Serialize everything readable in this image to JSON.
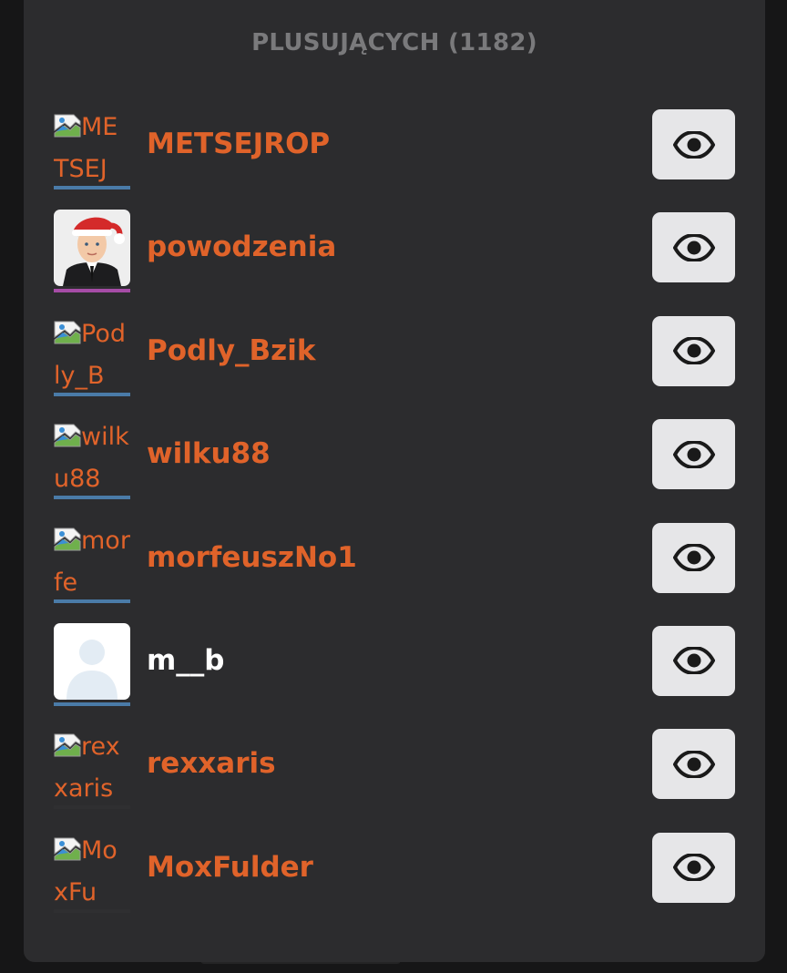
{
  "modal": {
    "title": "PLUSUJĄCYCH (1182)"
  },
  "colors": {
    "accent": "#e0632a",
    "name_white": "#ffffff",
    "bar_blue": "#4a7ba8",
    "bar_purple": "#a64ca6",
    "bar_dark": "#2f2f31"
  },
  "users": [
    {
      "name": "METSEJROP",
      "alt": "METSEJ",
      "avatar": "broken",
      "name_color": "#e0632a",
      "bar": "#4a7ba8"
    },
    {
      "name": "powodzenia",
      "alt": "",
      "avatar": "photo-santa",
      "name_color": "#e0632a",
      "bar": "#a64ca6"
    },
    {
      "name": "Podly_Bzik",
      "alt": "Podly_B",
      "avatar": "broken",
      "name_color": "#e0632a",
      "bar": "#4a7ba8"
    },
    {
      "name": "wilku88",
      "alt": "wilku88",
      "avatar": "broken",
      "name_color": "#e0632a",
      "bar": "#4a7ba8"
    },
    {
      "name": "morfeuszNo1",
      "alt": "morfe",
      "avatar": "broken",
      "name_color": "#e0632a",
      "bar": "#4a7ba8"
    },
    {
      "name": "m__b",
      "alt": "",
      "avatar": "default-silhouette",
      "name_color": "#ffffff",
      "bar": "#4a7ba8"
    },
    {
      "name": "rexxaris",
      "alt": "rexxaris",
      "avatar": "broken",
      "name_color": "#e0632a",
      "bar": "#2f2f31"
    },
    {
      "name": "MoxFulder",
      "alt": "MoxFu",
      "avatar": "broken",
      "name_color": "#e0632a",
      "bar": "#2f2f31"
    }
  ],
  "icons": {
    "view_button": "eye-icon",
    "broken_image": "broken-image-icon"
  }
}
